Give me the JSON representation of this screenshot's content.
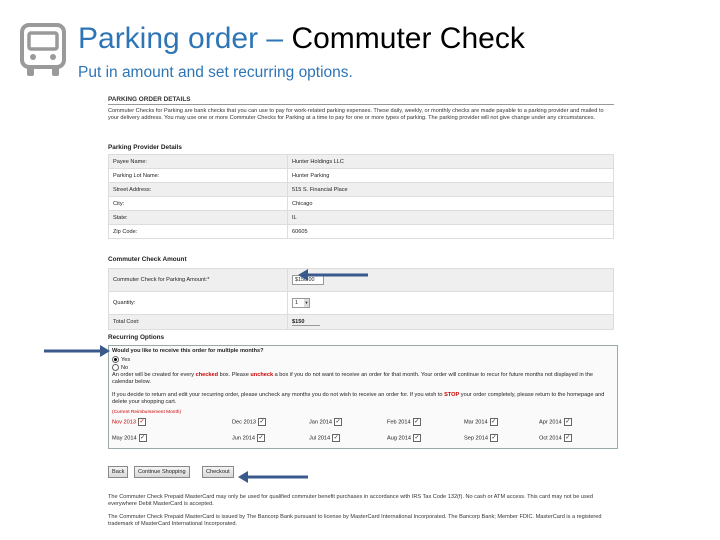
{
  "slide": {
    "title_part1": "Parking order –",
    "title_part2": " Commuter Check",
    "subtitle": "Put in amount and set recurring options."
  },
  "order": {
    "header": "PARKING ORDER DETAILS",
    "intro": "Commuter Checks for Parking are bank checks that you can use to pay for work-related parking expenses. These daily, weekly, or monthly checks are made payable to a parking provider and mailed to your delivery address. You may use one or more Commuter Checks for Parking at a time to pay for one or more types of parking. The parking provider will not give change under any circumstances.",
    "provider_header": "Parking Provider Details",
    "provider_rows": [
      {
        "label": "Payee Name:",
        "value": "Hunter Holdings LLC"
      },
      {
        "label": "Parking Lot Name:",
        "value": "Hunter Parking"
      },
      {
        "label": "Street Address:",
        "value": "515 S. Financial Place"
      },
      {
        "label": "City:",
        "value": "Chicago"
      },
      {
        "label": "State:",
        "value": "IL"
      },
      {
        "label": "Zip Code:",
        "value": "60605"
      }
    ],
    "amount_header": "Commuter Check Amount",
    "amount_label": "Commuter Check for Parking Amount:*",
    "amount_value": "$150.00",
    "quantity_label": "Quantity:",
    "quantity_value": "1",
    "total_label": "Total Cost:",
    "total_value": "$150",
    "recurring_header": "Recurring Options",
    "recurring_question": "Would you like to receive this order for multiple months?",
    "yes_label": "Yes",
    "no_label": "No",
    "rec_text_a": "An order will be created for every ",
    "rec_text_red1": "checked",
    "rec_text_b": " box. Please ",
    "rec_text_red2": "uncheck",
    "rec_text_c": " a box if you do not want to receive an order for that month. Your order will continue to recur for future months not displayed in the calendar below.",
    "rec_text_d": "If you decide to return and edit your recurring order, please uncheck any months you do not wish to receive an order for. If you wish to ",
    "rec_text_red3": "STOP",
    "rec_text_e": " your order completely, please return to the homepage and delete your shopping cart.",
    "current_month_label": "(Current Reimbursement Month)",
    "months_row1": [
      "Nov 2013",
      "Dec 2013",
      "Jan 2014",
      "Feb 2014",
      "Mar 2014",
      "Apr 2014"
    ],
    "months_row2": [
      "May 2014",
      "Jun 2014",
      "Jul 2014",
      "Aug 2014",
      "Sep 2014",
      "Oct 2014"
    ],
    "buttons": {
      "back": "Back",
      "continue": "Continue Shopping",
      "checkout": "Checkout"
    },
    "footer1": "The Commuter Check Prepaid MasterCard may only be used for qualified commuter benefit purchases in accordance with IRS Tax Code 132(f). No cash or ATM access. This card may not be used everywhere Debit MasterCard is accepted.",
    "footer2": "The Commuter Check Prepaid MasterCard is issued by The Bancorp Bank pursuant to license by MasterCard International Incorporated. The Bancorp Bank; Member FDIC. MasterCard is a registered trademark of MasterCard International Incorporated."
  },
  "colors": {
    "accent": "#2e75b6",
    "red": "#cc0000"
  }
}
